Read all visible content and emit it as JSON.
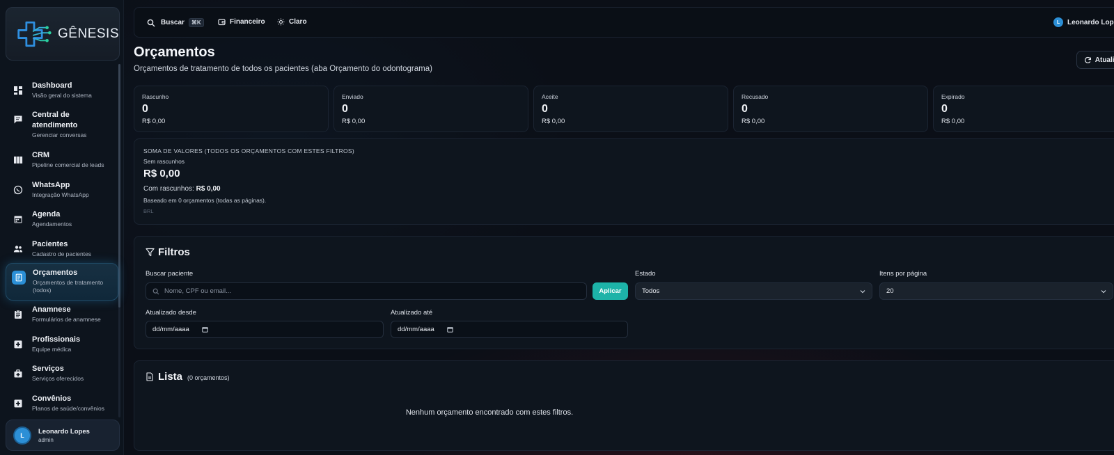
{
  "app": {
    "name": "GÊNESIS"
  },
  "sidebar": {
    "items": [
      {
        "title": "Dashboard",
        "subtitle": "Visão geral do sistema",
        "icon": "dashboard-icon"
      },
      {
        "title": "Central de atendimento",
        "subtitle": "Gerenciar conversas",
        "icon": "chat-icon"
      },
      {
        "title": "CRM",
        "subtitle": "Pipeline comercial de leads",
        "icon": "columns-icon"
      },
      {
        "title": "WhatsApp",
        "subtitle": "Integração WhatsApp",
        "icon": "whatsapp-icon"
      },
      {
        "title": "Agenda",
        "subtitle": "Agendamentos",
        "icon": "calendar-icon"
      },
      {
        "title": "Pacientes",
        "subtitle": "Cadastro de pacientes",
        "icon": "people-icon"
      },
      {
        "title": "Orçamentos",
        "subtitle": "Orçamentos de tratamento (todos)",
        "icon": "receipt-icon",
        "active": true
      },
      {
        "title": "Anamnese",
        "subtitle": "Formulários de anamnese",
        "icon": "clipboard-icon"
      },
      {
        "title": "Profissionais",
        "subtitle": "Equipe médica",
        "icon": "medical-plus-icon"
      },
      {
        "title": "Serviços",
        "subtitle": "Serviços oferecidos",
        "icon": "medical-bag-icon"
      },
      {
        "title": "Convênios",
        "subtitle": "Planos de saúde/convênios",
        "icon": "medical-plus-icon"
      }
    ],
    "user": {
      "initial": "L",
      "name": "Leonardo Lopes",
      "role": "admin"
    }
  },
  "topbar": {
    "search_label": "Buscar",
    "search_shortcut": "⌘K",
    "finance_label": "Financeiro",
    "theme_label": "Claro",
    "user_initial": "L",
    "user_name": "Leonardo Lopes"
  },
  "page": {
    "title": "Orçamentos",
    "subtitle": "Orçamentos de tratamento de todos os pacientes (aba Orçamento do odontograma)",
    "refresh_label": "Atualizar"
  },
  "stats": [
    {
      "label": "Rascunho",
      "count": "0",
      "amount": "R$ 0,00"
    },
    {
      "label": "Enviado",
      "count": "0",
      "amount": "R$ 0,00"
    },
    {
      "label": "Aceite",
      "count": "0",
      "amount": "R$ 0,00"
    },
    {
      "label": "Recusado",
      "count": "0",
      "amount": "R$ 0,00"
    },
    {
      "label": "Expirado",
      "count": "0",
      "amount": "R$ 0,00"
    }
  ],
  "summary": {
    "heading": "SOMA DE VALORES (TODOS OS ORÇAMENTOS COM ESTES FILTROS)",
    "without_drafts_label": "Sem rascunhos",
    "without_drafts_value": "R$ 0,00",
    "with_drafts_label": "Com rascunhos:",
    "with_drafts_value": "R$ 0,00",
    "based_on": "Baseado em 0 orçamentos (todas as páginas).",
    "currency": "BRL"
  },
  "filters": {
    "title": "Filtros",
    "search_label": "Buscar paciente",
    "search_placeholder": "Nome, CPF ou email...",
    "apply_label": "Aplicar",
    "state_label": "Estado",
    "state_value": "Todos",
    "per_page_label": "Itens por página",
    "per_page_value": "20",
    "from_label": "Atualizado desde",
    "from_value": "dd/mm/aaaa",
    "to_label": "Atualizado até",
    "to_value": "dd/mm/aaaa"
  },
  "list": {
    "title": "Lista",
    "count": "(0 orçamentos)",
    "empty": "Nenhum orçamento encontrado com estes filtros."
  },
  "colors": {
    "accent": "#2b8fd6",
    "apply": "#1db3a8",
    "background": "#0b0f17"
  }
}
